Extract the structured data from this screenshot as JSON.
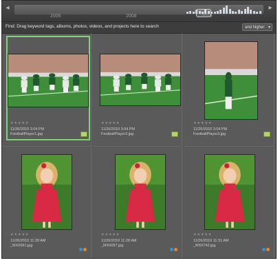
{
  "find_bar": {
    "text": "Find: Drag keyword tags, albums, photos, videos, and projects here to search",
    "rating_filter": "and higher"
  },
  "timeline": {
    "bars": [
      2,
      3,
      2,
      4,
      3,
      2,
      5,
      3,
      2,
      2,
      3,
      4,
      6,
      8,
      5,
      3,
      2,
      4,
      3,
      5,
      7,
      4,
      3,
      2,
      3
    ],
    "labels": [
      "2006",
      "2008",
      "2010"
    ]
  },
  "photos": [
    {
      "stars": "★★★★★",
      "date": "11/26/2010 3:04 PM",
      "filename": "FootballPlayer1.jpg",
      "tagged": true,
      "selected": true,
      "palette": "football"
    },
    {
      "stars": "★★★★★",
      "date": "11/26/2010 3:04 PM",
      "filename": "FootballPlayer2.jpg",
      "tagged": true,
      "selected": false,
      "palette": "football"
    },
    {
      "stars": "★★★★★",
      "date": "11/26/2010 3:04 PM",
      "filename": "FootballPlayer3.jpg",
      "tagged": true,
      "selected": false,
      "palette": "football"
    },
    {
      "stars": "★★★★★",
      "date": "11/26/2010 11:28 AM",
      "filename": "_MX0091.jpg",
      "tagged": false,
      "selected": false,
      "palette": "girl"
    },
    {
      "stars": "★★★★★",
      "date": "11/26/2010 11:28 AM",
      "filename": "_MX0097.jpg",
      "tagged": false,
      "selected": false,
      "palette": "girl"
    },
    {
      "stars": "★★★★★",
      "date": "11/26/2010 11:31 AM",
      "filename": "_MX0742.jpg",
      "tagged": false,
      "selected": false,
      "palette": "girl"
    }
  ],
  "colors": {
    "selection": "#7fd37a",
    "tag": "#b5d36a",
    "dot_blue": "#3a8fd9",
    "dot_orange": "#e08a2a"
  }
}
